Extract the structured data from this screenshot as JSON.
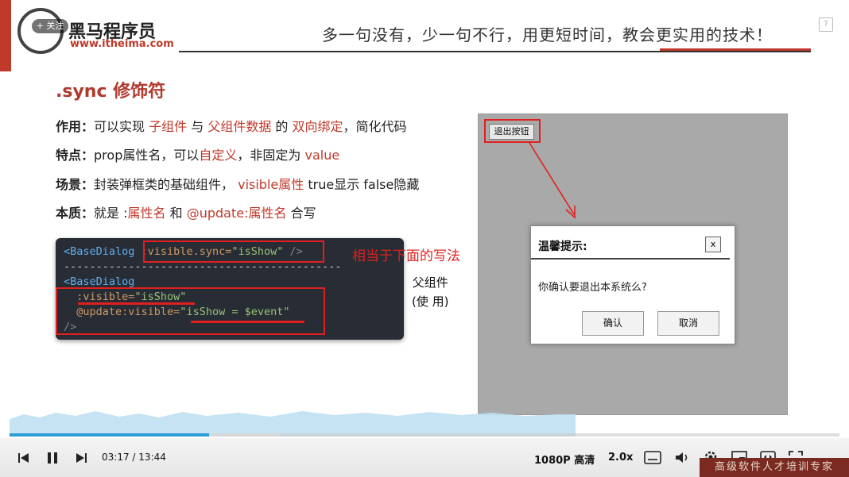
{
  "header": {
    "follow_label": "+ 关注",
    "brand": "黑马程序员",
    "brand_url": "www.itheima.com",
    "slogan": "多一句没有，少一句不行，用更短时间，教会更实用的技术！",
    "help_icon": "?"
  },
  "content": {
    "title": ".sync 修饰符",
    "lines": [
      {
        "label": "作用：",
        "parts": [
          "可以实现 ",
          "子组件",
          " 与 ",
          "父组件数据",
          " 的 ",
          "双向绑定",
          "，简化代码"
        ]
      },
      {
        "label": "特点：",
        "parts": [
          "prop属性名，可以",
          "自定义",
          "，非固定为 ",
          "value"
        ]
      },
      {
        "label": "场景：",
        "parts": [
          "封装弹框类的基础组件，  ",
          "visible属性",
          "  true显示 false隐藏"
        ]
      },
      {
        "label": "本质：",
        "parts": [
          "就是 :",
          "属性名",
          " 和 ",
          "@update:属性名",
          " 合写"
        ]
      }
    ]
  },
  "code": {
    "line1_tag": "<BaseDialog",
    "line1_attr": ":visible.sync=",
    "line1_str": "\"isShow\"",
    "line1_end": " />",
    "separator": "-------------------------------------------",
    "line3_tag": "<BaseDialog",
    "line4_attr": "  :visible=",
    "line4_str": "\"isShow\"",
    "line5_attr": "  @update:visible=",
    "line5_str": "\"isShow = $event\"",
    "line6": "/>"
  },
  "annotations": {
    "equivalent": "相当于下面的写法",
    "parent_line1": "父组件",
    "parent_line2": "(使  用)"
  },
  "demo": {
    "exit_button": "退出按钮",
    "dialog_title": "温馨提示:",
    "dialog_close": "x",
    "dialog_message": "你确认要退出本系统么?",
    "confirm_button": "确认",
    "cancel_button": "取消"
  },
  "player": {
    "current_time": "03:17",
    "time_separator": "/",
    "total_time": "13:44",
    "progress": 0.24,
    "quality": "1080P 高清",
    "speed": "2.0x",
    "watermark": "高级软件人才培训专家",
    "accent_color": "#2a9fd6"
  }
}
